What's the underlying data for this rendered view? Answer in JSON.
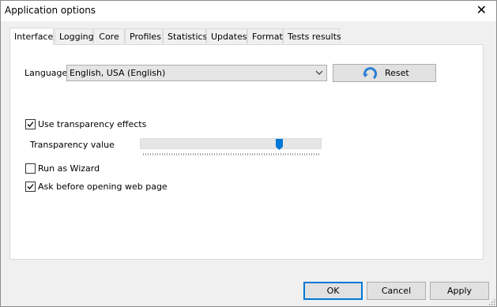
{
  "window": {
    "title": "Application options",
    "close_glyph": "✕"
  },
  "tabs": [
    {
      "label": "Interface",
      "active": true
    },
    {
      "label": "Logging"
    },
    {
      "label": "Core"
    },
    {
      "label": "Profiles"
    },
    {
      "label": "Statistics"
    },
    {
      "label": "Updates"
    },
    {
      "label": "Format"
    },
    {
      "label": "Tests results"
    }
  ],
  "language": {
    "label": "Language:",
    "value": "English, USA (English)"
  },
  "reset": {
    "label": "Reset",
    "icon": "refresh-arrow-icon"
  },
  "transparency": {
    "checkbox_label": "Use transparency effects",
    "checked": true,
    "value_label": "Transparency value",
    "slider_fraction": 0.78
  },
  "wizard": {
    "label": "Run as Wizard",
    "checked": false
  },
  "ask_web": {
    "label": "Ask before opening web page",
    "checked": true
  },
  "buttons": {
    "ok": "OK",
    "cancel": "Cancel",
    "apply": "Apply"
  },
  "colors": {
    "accent": "#0078d7"
  }
}
